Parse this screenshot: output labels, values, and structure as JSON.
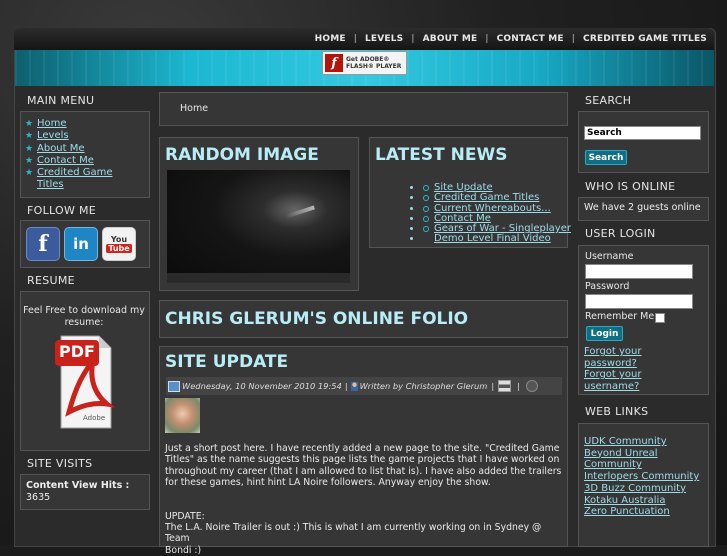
{
  "nav": {
    "items": [
      "HOME",
      "LEVELS",
      "ABOUT ME",
      "CONTACT ME",
      "CREDITED GAME TITLES"
    ],
    "sep": "|"
  },
  "flash": {
    "line1": "Get ADOBE®",
    "line2": "FLASH® PLAYER",
    "icon": "flash-player-icon"
  },
  "main_menu": {
    "title": "MAIN MENU",
    "items": [
      "Home",
      "Levels",
      "About Me",
      "Contact Me",
      "Credited Game",
      "Titles"
    ]
  },
  "follow": {
    "title": "FOLLOW ME",
    "facebook": "f",
    "linkedin": "in",
    "youtube_you": "You",
    "youtube_tube": "Tube"
  },
  "resume": {
    "title": "RESUME",
    "text": "Feel Free to download my resume:",
    "pdf_label": "PDF",
    "adobe_label": "Adobe"
  },
  "visits": {
    "title": "SITE VISITS",
    "label": "Content View Hits :",
    "count": "3635"
  },
  "breadcrumb": {
    "home": "Home"
  },
  "random_image": {
    "title": "RANDOM IMAGE"
  },
  "latest_news": {
    "title": "LATEST NEWS",
    "items": [
      "Site Update",
      "Credited Game Titles",
      "Current Whereabouts...",
      "Contact Me",
      "Gears of War - Singleplayer",
      "Demo Level Final Video"
    ]
  },
  "folio": {
    "title": "CHRIS GLERUM'S ONLINE FOLIO"
  },
  "article": {
    "title": "SITE UPDATE",
    "date": "Wednesday, 10 November 2010 19:54",
    "author": "Written by Christopher Glerum",
    "sep": "|",
    "lines": [
      "Just a short post here.  I have recently added a new page to the site.  \"Credited Game",
      "Titles\" as the name suggests this page lists the game projects that I have worked on",
      "throughout my career (that I am allowed to list that is).  I have also added the trailers",
      "for these games, hint hint LA Noire followers.  Anyway enjoy the show.",
      "",
      "",
      "UPDATE:",
      "The L.A. Noire Trailer is out :)  This is what I am currently working on in Sydney @ Team",
      "Bondi :)"
    ]
  },
  "search": {
    "title": "SEARCH",
    "placeholder": "Search",
    "button": "Search"
  },
  "online": {
    "title": "WHO IS ONLINE",
    "text": "We have 2 guests online"
  },
  "login": {
    "title": "USER LOGIN",
    "username": "Username",
    "password": "Password",
    "remember": "Remember Me",
    "button": "Login",
    "forgot_pw": [
      "Forgot your",
      "password?"
    ],
    "forgot_user": [
      "Forgot your",
      "username?"
    ]
  },
  "weblinks": {
    "title": "WEB LINKS",
    "items": [
      "UDK Community",
      "Beyond Unreal",
      "Community",
      "Interlopers Community",
      "3D Buzz Community",
      "Kotaku Australia",
      "Zero Punctuation"
    ]
  },
  "colors": {
    "accent": "#2bb8d1",
    "link": "#9fdcea",
    "heading": "#b8edf6",
    "panel": "#363636"
  }
}
